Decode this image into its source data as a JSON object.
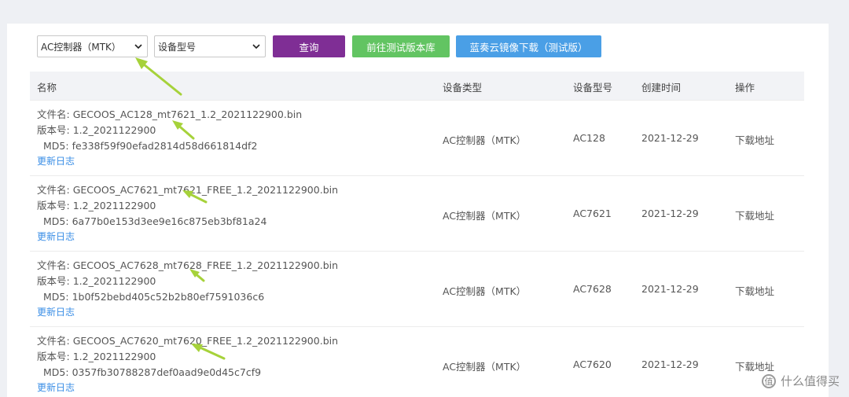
{
  "toolbar": {
    "controller_select": "AC控制器（MTK）",
    "model_select": "设备型号",
    "query_label": "查询",
    "test_repo_label": "前往测试版本库",
    "mirror_label": "蓝奏云镜像下载（测试版）",
    "colors": {
      "query": "#7f2e95",
      "test_repo": "#62c462",
      "mirror": "#4a9fe6"
    }
  },
  "table": {
    "headers": [
      "名称",
      "设备类型",
      "设备型号",
      "创建时间",
      "操作"
    ],
    "rows": [
      {
        "filename_label": "文件名:",
        "filename": "GECOOS_AC128_mt7621_1.2_2021122900.bin",
        "version_label": "版本号:",
        "version": "1.2_2021122900",
        "md5_label": "MD5:",
        "md5": "fe338f59f90efad2814d58d661814df2",
        "log": "更新日志",
        "type": "AC控制器（MTK）",
        "model": "AC128",
        "date": "2021-12-29",
        "action": "下载地址"
      },
      {
        "filename_label": "文件名:",
        "filename": "GECOOS_AC7621_mt7621_FREE_1.2_2021122900.bin",
        "version_label": "版本号:",
        "version": "1.2_2021122900",
        "md5_label": "MD5:",
        "md5": "6a77b0e153d3ee9e16c875eb3bf81a24",
        "log": "更新日志",
        "type": "AC控制器（MTK）",
        "model": "AC7621",
        "date": "2021-12-29",
        "action": "下载地址"
      },
      {
        "filename_label": "文件名:",
        "filename": "GECOOS_AC7628_mt7628_FREE_1.2_2021122900.bin",
        "version_label": "版本号:",
        "version": "1.2_2021122900",
        "md5_label": "MD5:",
        "md5": "1b0f52bebd405c52b2b80ef7591036c6",
        "log": "更新日志",
        "type": "AC控制器（MTK）",
        "model": "AC7628",
        "date": "2021-12-29",
        "action": "下载地址"
      },
      {
        "filename_label": "文件名:",
        "filename": "GECOOS_AC7620_mt7620_FREE_1.2_2021122900.bin",
        "version_label": "版本号:",
        "version": "1.2_2021122900",
        "md5_label": "MD5:",
        "md5": "0357fb30788287def0aad9e0d45c7cf9",
        "log": "更新日志",
        "type": "AC控制器（MTK）",
        "model": "AC7620",
        "date": "2021-12-29",
        "action": "下载地址"
      }
    ]
  },
  "watermark": {
    "logo_char": "值",
    "text": "什么值得买"
  },
  "annotation_color": "#a6d23a"
}
